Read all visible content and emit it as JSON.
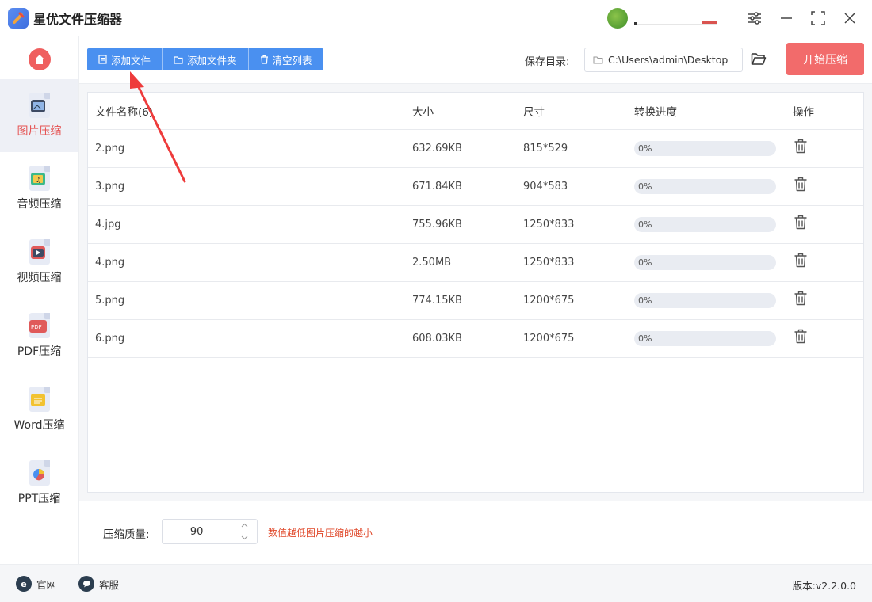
{
  "app": {
    "title": "星优文件压缩器"
  },
  "sidebar": {
    "items": [
      {
        "label": "图片压缩",
        "icon": "image-icon",
        "active": true
      },
      {
        "label": "音频压缩",
        "icon": "audio-icon"
      },
      {
        "label": "视频压缩",
        "icon": "video-icon"
      },
      {
        "label": "PDF压缩",
        "icon": "pdf-icon"
      },
      {
        "label": "Word压缩",
        "icon": "word-icon"
      },
      {
        "label": "PPT压缩",
        "icon": "ppt-icon"
      }
    ]
  },
  "toolbar": {
    "add_file": "添加文件",
    "add_folder": "添加文件夹",
    "clear_list": "清空列表",
    "save_label": "保存目录:",
    "save_path": "C:\\Users\\admin\\Desktop",
    "start": "开始压缩"
  },
  "table": {
    "headers": [
      "文件名称(6)",
      "大小",
      "尺寸",
      "转换进度",
      "操作"
    ],
    "rows": [
      {
        "name": "2.png",
        "size": "632.69KB",
        "dims": "815*529",
        "progress": "0%"
      },
      {
        "name": "3.png",
        "size": "671.84KB",
        "dims": "904*583",
        "progress": "0%"
      },
      {
        "name": "4.jpg",
        "size": "755.96KB",
        "dims": "1250*833",
        "progress": "0%"
      },
      {
        "name": "4.png",
        "size": "2.50MB",
        "dims": "1250*833",
        "progress": "0%"
      },
      {
        "name": "5.png",
        "size": "774.15KB",
        "dims": "1200*675",
        "progress": "0%"
      },
      {
        "name": "6.png",
        "size": "608.03KB",
        "dims": "1200*675",
        "progress": "0%"
      }
    ]
  },
  "quality": {
    "label": "压缩质量:",
    "value": "90",
    "hint": "数值越低图片压缩的越小"
  },
  "status": {
    "website": "官网",
    "support": "客服",
    "version": "版本:v2.2.0.0"
  },
  "colors": {
    "primary": "#4a90f0",
    "accent": "#f26b6b",
    "hint": "#e0482a"
  }
}
